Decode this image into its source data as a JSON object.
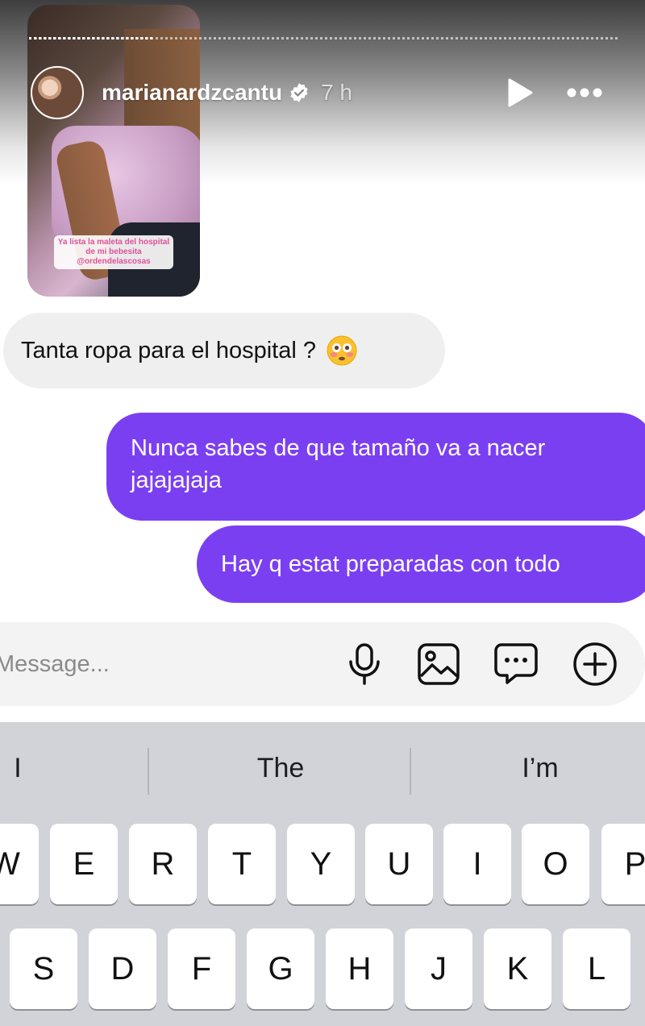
{
  "story": {
    "username": "marianardzcantu",
    "time": "7 h",
    "progress": 0.21,
    "caption": "Ya lista la maleta del hospital de mi bebesita @ordendelascosas",
    "icons": {
      "verified": "verified-badge-icon",
      "play": "play-icon",
      "more": "more-horizontal-icon"
    }
  },
  "messages": [
    {
      "direction": "incoming",
      "text": "Tanta ropa para el hospital ?",
      "emoji": "flushed-face-emoji"
    },
    {
      "direction": "outgoing",
      "text": "Nunca sabes de que tamaño va a nacer jajajajaja"
    },
    {
      "direction": "outgoing",
      "text": "Hay q estat preparadas con todo"
    }
  ],
  "composer": {
    "placeholder": "Message...",
    "icons": [
      "microphone-icon",
      "image-icon",
      "sticker-icon",
      "plus-circle-icon"
    ]
  },
  "keyboard": {
    "suggestions": [
      "I",
      "The",
      "I’m"
    ],
    "row1": [
      "W",
      "E",
      "R",
      "T",
      "Y",
      "U",
      "I",
      "O",
      "P"
    ],
    "row2": [
      "S",
      "D",
      "F",
      "G",
      "H",
      "J",
      "K",
      "L"
    ]
  },
  "colors": {
    "outgoing_bubble": "#7b3ff2",
    "incoming_bubble": "#efefef",
    "keyboard_bg": "#d1d3d9"
  }
}
